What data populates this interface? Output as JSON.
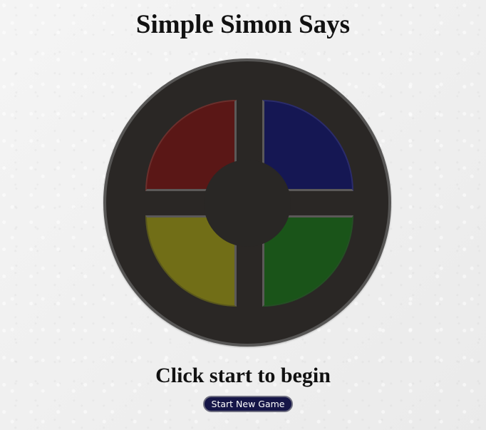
{
  "page": {
    "title": "Simple Simon Says"
  },
  "game": {
    "status": "Click start to begin",
    "start_button": "Start New Game",
    "pads": {
      "red": {
        "color": "#5a1716"
      },
      "blue": {
        "color": "#151753"
      },
      "yellow": {
        "color": "#716e17"
      },
      "green": {
        "color": "#1a5419"
      }
    },
    "board_color": "#2a2725",
    "ring_color": "#575655"
  }
}
